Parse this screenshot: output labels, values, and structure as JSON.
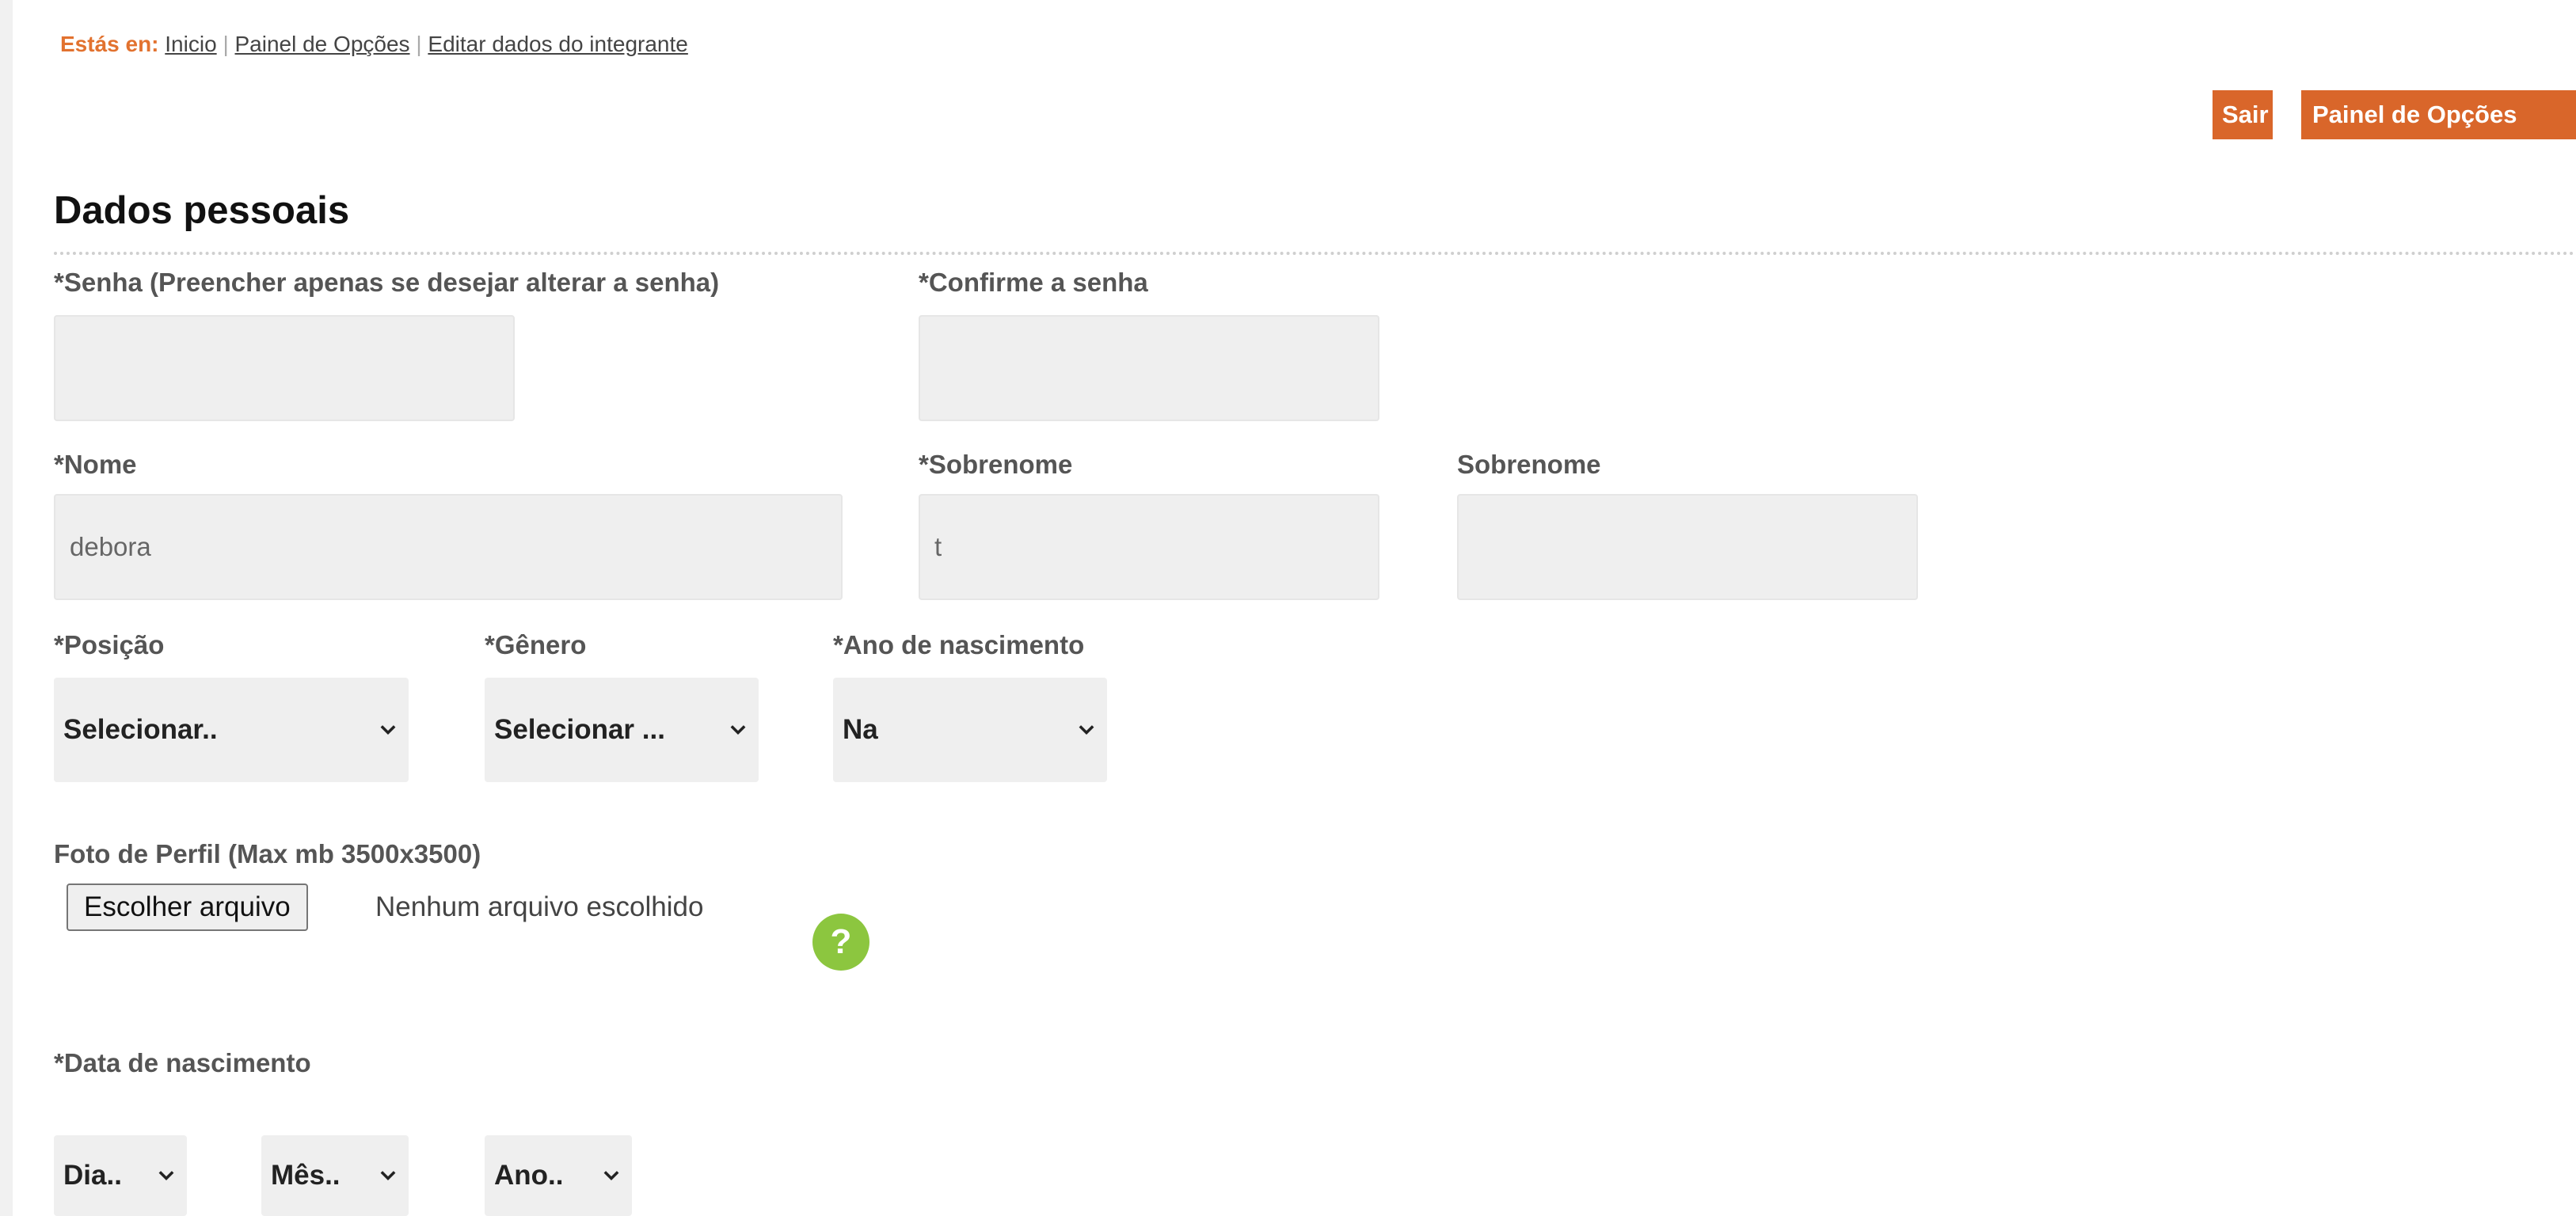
{
  "breadcrumb": {
    "lead": "Estás en:",
    "items": [
      "Inicio",
      "Painel de Opções",
      "Editar dados do integrante"
    ],
    "separator": "|"
  },
  "header_buttons": {
    "logout": "Sair",
    "options_panel": "Painel de Opções"
  },
  "section": {
    "title": "Dados pessoais"
  },
  "fields": {
    "password": {
      "label": "*Senha (Preencher apenas se desejar alterar a senha)",
      "value": ""
    },
    "confirm_password": {
      "label": "*Confirme a senha",
      "value": ""
    },
    "first_name": {
      "label": "*Nome",
      "value": "debora"
    },
    "last_name": {
      "label": "*Sobrenome",
      "value": "t"
    },
    "second_last_name": {
      "label": "Sobrenome",
      "value": ""
    },
    "position": {
      "label": "*Posição",
      "selected": "Selecionar.."
    },
    "gender": {
      "label": "*Gênero",
      "selected": "Selecionar ..."
    },
    "birth_year": {
      "label": "*Ano de nascimento",
      "selected": "Na"
    },
    "profile_photo": {
      "label": "Foto de Perfil (Max mb 3500x3500)",
      "button": "Escolher arquivo",
      "status": "Nenhum arquivo escolhido",
      "help": "?"
    },
    "birth_date": {
      "label": "*Data de nascimento",
      "day": "Dia..",
      "month": "Mês..",
      "year": "Ano.."
    }
  },
  "colors": {
    "accent": "#d9662a",
    "help": "#8cc63f",
    "field_bg": "#efefef"
  },
  "icons": {
    "select_arrow": "chevron-down-icon",
    "help": "question-mark-icon"
  }
}
